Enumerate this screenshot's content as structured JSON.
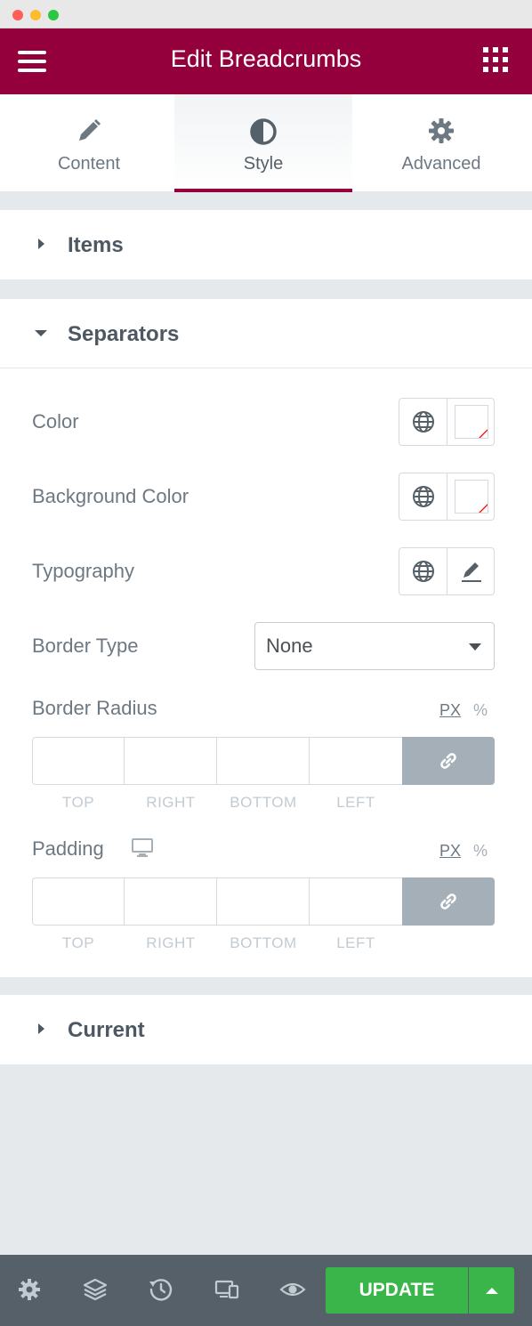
{
  "window": {
    "controls": [
      "close",
      "minimize",
      "maximize"
    ]
  },
  "header": {
    "title": "Edit Breadcrumbs",
    "menu_icon": "hamburger-icon",
    "apps_icon": "grid-icon",
    "background": "#93003c"
  },
  "tabs": [
    {
      "label": "Content",
      "icon": "pencil-icon",
      "active": false
    },
    {
      "label": "Style",
      "icon": "contrast-icon",
      "active": true
    },
    {
      "label": "Advanced",
      "icon": "gear-icon",
      "active": false
    }
  ],
  "sections": {
    "items": {
      "title": "Items",
      "expanded": false
    },
    "separators": {
      "title": "Separators",
      "expanded": true,
      "controls": {
        "color": {
          "label": "Color",
          "global_icon": "globe-icon",
          "value": "none"
        },
        "background_color": {
          "label": "Background Color",
          "global_icon": "globe-icon",
          "value": "none"
        },
        "typography": {
          "label": "Typography",
          "global_icon": "globe-icon",
          "edit_icon": "pencil-icon"
        },
        "border_type": {
          "label": "Border Type",
          "value": "None"
        },
        "border_radius": {
          "label": "Border Radius",
          "units": [
            "PX",
            "%"
          ],
          "active_unit": "PX",
          "sides": [
            "TOP",
            "RIGHT",
            "BOTTOM",
            "LEFT"
          ],
          "link_icon": "link-icon"
        },
        "padding": {
          "label": "Padding",
          "device_icon": "desktop-icon",
          "units": [
            "PX",
            "%"
          ],
          "active_unit": "PX",
          "sides": [
            "TOP",
            "RIGHT",
            "BOTTOM",
            "LEFT"
          ],
          "link_icon": "link-icon"
        }
      }
    },
    "current": {
      "title": "Current",
      "expanded": false
    }
  },
  "footer": {
    "tools": [
      "settings-icon",
      "layers-icon",
      "history-icon",
      "responsive-icon",
      "eye-icon"
    ],
    "update_label": "UPDATE",
    "update_color": "#39b54a"
  }
}
